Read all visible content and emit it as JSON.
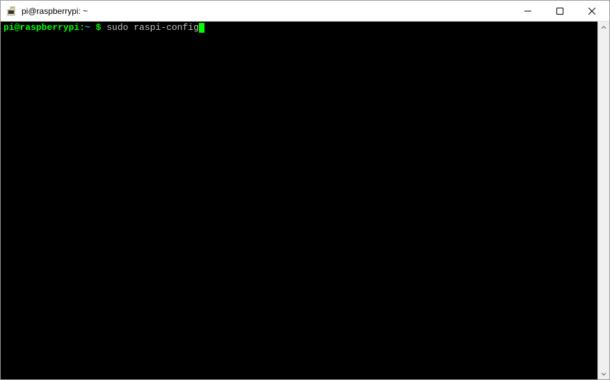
{
  "window": {
    "title": "pi@raspberrypi: ~"
  },
  "terminal": {
    "prompt_user_host": "pi@raspberrypi",
    "prompt_separator": ":",
    "prompt_path": "~",
    "prompt_symbol": " $ ",
    "command": "sudo raspi-config"
  }
}
